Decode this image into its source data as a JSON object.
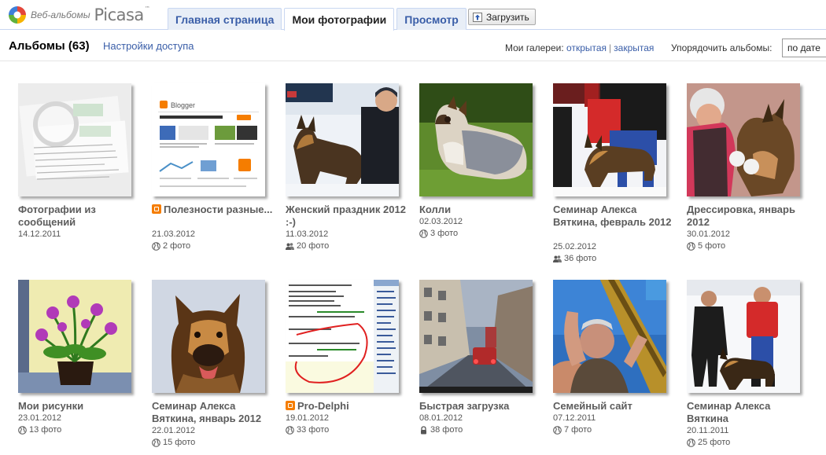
{
  "logo": {
    "small": "Веб-альбомы",
    "big": "Picasa",
    "tm": "™"
  },
  "tabs": [
    {
      "label": "Главная страница",
      "active": false
    },
    {
      "label": "Мои фотографии",
      "active": true
    },
    {
      "label": "Просмотр",
      "active": false
    }
  ],
  "upload": {
    "label": "Загрузить",
    "icon": "upload-icon"
  },
  "subheader": {
    "title": "Альбомы (63)",
    "access_link": "Настройки доступа",
    "galleries_label": "Мои галереи:",
    "gallery_public": "открытая",
    "gallery_separator": "|",
    "gallery_private": "закрытая",
    "sort_label": "Упорядочить альбомы:",
    "sort_value": "по дате"
  },
  "colors": {
    "link": "#3a5ea8",
    "tab_bg": "#e8eef7",
    "border": "#c9d7f1"
  },
  "albums": [
    {
      "title": "Фотографии из сообщений",
      "date": "14.12.2011",
      "count": "",
      "visibility": "",
      "blogger": false
    },
    {
      "title": "Полезности разные...",
      "date": "21.03.2012",
      "count": "2 фото",
      "visibility": "globe-icon",
      "blogger": true
    },
    {
      "title": "Женский праздник 2012 :-)",
      "date": "11.03.2012",
      "count": "20 фото",
      "visibility": "people-icon",
      "blogger": false
    },
    {
      "title": "Колли",
      "date": "02.03.2012",
      "count": "3 фото",
      "visibility": "globe-icon",
      "blogger": false
    },
    {
      "title": "Семинар Алекса Вяткина, февраль 2012",
      "date": "25.02.2012",
      "count": "36 фото",
      "visibility": "people-icon",
      "blogger": false
    },
    {
      "title": "Дрессировка, январь 2012",
      "date": "30.01.2012",
      "count": "5 фото",
      "visibility": "globe-icon",
      "blogger": false
    },
    {
      "title": "Мои рисунки",
      "date": "23.01.2012",
      "count": "13 фото",
      "visibility": "globe-icon",
      "blogger": false
    },
    {
      "title": "Семинар Алекса Вяткина, январь 2012",
      "date": "22.01.2012",
      "count": "15 фото",
      "visibility": "globe-icon",
      "blogger": false
    },
    {
      "title": "Pro-Delphi",
      "date": "19.01.2012",
      "count": "33 фото",
      "visibility": "globe-icon",
      "blogger": true
    },
    {
      "title": "Быстрая загрузка",
      "date": "08.01.2012",
      "count": "38 фото",
      "visibility": "lock-icon",
      "blogger": false
    },
    {
      "title": "Семейный сайт",
      "date": "07.12.2011",
      "count": "7 фото",
      "visibility": "globe-icon",
      "blogger": false
    },
    {
      "title": "Семинар Алекса Вяткина",
      "date": "20.11.2011",
      "count": "25 фото",
      "visibility": "globe-icon",
      "blogger": false
    }
  ]
}
